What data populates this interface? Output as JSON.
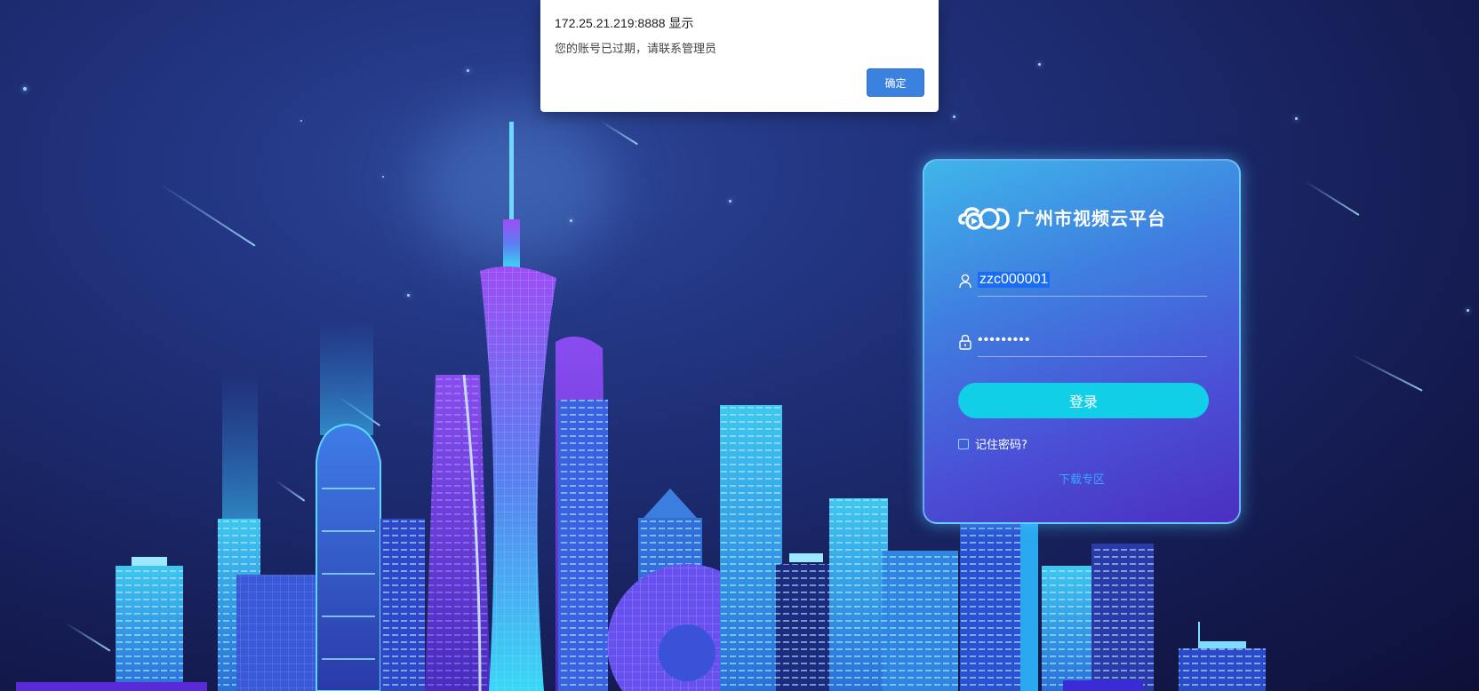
{
  "dialog": {
    "title": "172.25.21.219:8888 显示",
    "message": "您的账号已过期，请联系管理员",
    "ok_label": "确定"
  },
  "login": {
    "brand_name": "广州市视频云平台",
    "username_value": "zzc000001",
    "password_masked": "•••••••••",
    "submit_label": "登录",
    "remember_label": "记住密码?",
    "download_link": "下载专区"
  },
  "icons": {
    "brand": "cloud-play-logo-icon",
    "user": "user-icon",
    "password": "lock-icon"
  },
  "colors": {
    "dialog_button": "#3b82e0",
    "login_button": "#12cfe8",
    "download_link": "#39a6ff",
    "background_dark": "#141a4e"
  }
}
